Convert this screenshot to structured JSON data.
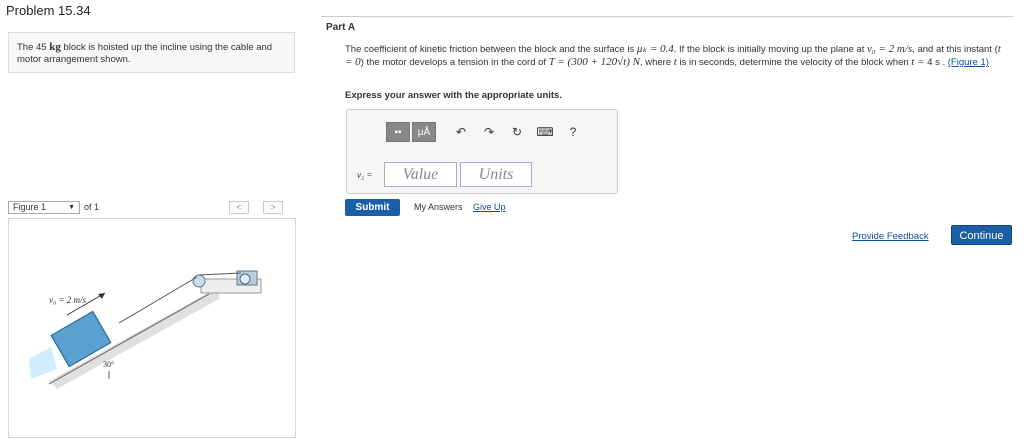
{
  "header": {
    "title": "Problem 15.34"
  },
  "problem": {
    "text_pre": "The 45 ",
    "unit": "kg",
    "text_post": " block is hoisted up the incline using the cable and motor arrangement shown."
  },
  "figure": {
    "select_value": "Figure 1",
    "of_label": "of 1",
    "prev_label": "<",
    "next_label": ">",
    "velocity_label": "v₀ = 2 m/s",
    "angle_label": "30°"
  },
  "part": {
    "title": "Part A",
    "q1": "The coefficient of kinetic friction between the block and the surface is ",
    "mu": "μₖ = 0.4",
    "q2": ". If the block is initially moving up the plane at ",
    "v0": "v₀ = 2 m/s",
    "q3": ", and at this instant (",
    "t0": "t = 0",
    "q4": ") the motor develops a tension in the cord of ",
    "T": "T = (300 + 120√t) N",
    "q5": ", where ",
    "t": "t",
    "q6": " is in seconds, determine the velocity of the block when ",
    "t4": "t =",
    "q7": " 4 s .",
    "figure_link": "(Figure 1)",
    "express": "Express your answer with the appropriate units."
  },
  "toolbar": {
    "units_button": "μÅ",
    "undo": "↶",
    "redo": "↷",
    "reset": "↻",
    "keyboard": "⌨",
    "help": "?"
  },
  "answer": {
    "variable": "v₂ =",
    "value_placeholder": "Value",
    "units_placeholder": "Units"
  },
  "actions": {
    "submit": "Submit",
    "my_answers": "My Answers",
    "give_up": "Give Up",
    "feedback": "Provide Feedback",
    "continue": "Continue"
  }
}
